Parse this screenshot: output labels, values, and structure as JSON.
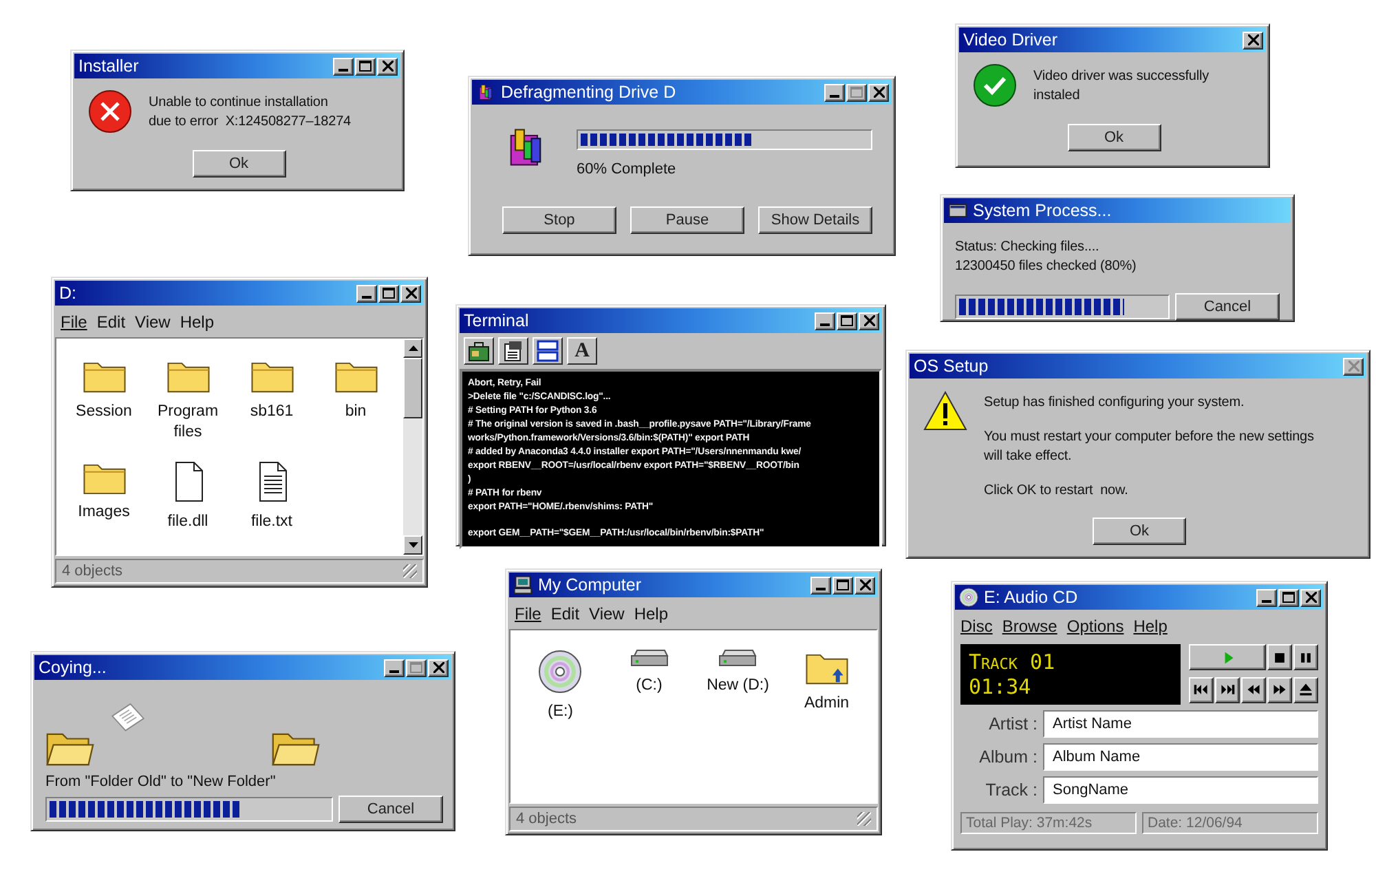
{
  "windows": [
    {
      "kind": "message",
      "title": "Installer",
      "title_buttons": [
        {
          "kind": "minimize",
          "disabled": false
        },
        {
          "kind": "maximize",
          "disabled": false
        },
        {
          "kind": "close",
          "disabled": false
        }
      ],
      "paragraphs": [
        "Unable to continue installation\ndue to error  X:124508277–18274"
      ],
      "buttons": [
        {
          "label": "Ok"
        }
      ]
    },
    {
      "kind": "progress",
      "title": "Defragmenting Drive D",
      "title_buttons": [
        {
          "kind": "minimize",
          "disabled": false
        },
        {
          "kind": "maximize",
          "disabled": true
        },
        {
          "kind": "close",
          "disabled": false
        }
      ],
      "level": 0.6,
      "caption": "60% Complete",
      "buttons": [
        {
          "label": "Stop"
        },
        {
          "label": "Pause"
        },
        {
          "label": "Show Details"
        }
      ]
    },
    {
      "kind": "message",
      "title": "Video Driver",
      "title_buttons": [
        {
          "kind": "close",
          "disabled": false
        }
      ],
      "paragraphs": [
        "Video driver was successfully\ninstaled"
      ],
      "buttons": [
        {
          "label": "Ok"
        }
      ]
    },
    {
      "kind": "status",
      "title": "System Process...",
      "paragraphs": [
        "Status: Checking files....\n12300450 files checked (80%)"
      ],
      "level": 0.8,
      "buttons": [
        {
          "label": "Cancel"
        }
      ]
    },
    {
      "kind": "message",
      "title": "OS Setup",
      "title_buttons": [
        {
          "kind": "close",
          "disabled": true
        }
      ],
      "paragraphs": [
        "Setup has finished configuring your system.",
        "You must restart your computer before the new settings\nwill take effect.",
        "Click OK to restart  now."
      ],
      "buttons": [
        {
          "label": "Ok"
        }
      ]
    },
    {
      "kind": "explorer",
      "title": "D:",
      "title_buttons": [
        {
          "kind": "minimize",
          "disabled": false
        },
        {
          "kind": "maximize",
          "disabled": false
        },
        {
          "kind": "close",
          "disabled": false
        }
      ],
      "menu": [
        {
          "label": "File",
          "underlined": true
        },
        {
          "label": "Edit",
          "underlined": false
        },
        {
          "label": "View",
          "underlined": false
        },
        {
          "label": "Help",
          "underlined": false
        }
      ],
      "items": [
        {
          "label": "Session",
          "kind": "folder"
        },
        {
          "label": "Program\nfiles",
          "kind": "folder"
        },
        {
          "label": "sb161",
          "kind": "folder"
        },
        {
          "label": "bin",
          "kind": "folder"
        },
        {
          "label": "Images",
          "kind": "folder"
        },
        {
          "label": "file.dll",
          "kind": "file"
        },
        {
          "label": "file.txt",
          "kind": "text-file"
        }
      ],
      "scrollbar": true,
      "status": "4 objects"
    },
    {
      "kind": "terminal",
      "title": "Terminal",
      "title_buttons": [
        {
          "kind": "minimize",
          "disabled": false
        },
        {
          "kind": "maximize",
          "disabled": false
        },
        {
          "kind": "close",
          "disabled": false
        }
      ],
      "toolbar": [
        {
          "kind": "briefcase"
        },
        {
          "kind": "properties"
        },
        {
          "kind": "windows"
        },
        {
          "kind": "font",
          "glyph": "A"
        }
      ],
      "blocks": [
        [
          "Abort, Retry, Fail",
          ">Delete file \"c:/SCANDISC.log\"...",
          "# Setting PATH for Python 3.6",
          "# The original version is saved in .bash__profile.pysave PATH=\"/Library/Frame",
          "works/Python.framework/Versions/3.6/bin:$(PATH)\" export PATH",
          "# added by Anaconda3 4.4.0 installer export PATH=\"/Users/nnenmandu kwe/",
          "export RBENV__ROOT=/usr/local/rbenv export PATH=\"$RBENV__ROOT/bin",
          ")",
          "# PATH for rbenv",
          "export PATH=\"HOME/.rbenv/shims: PATH\""
        ],
        [
          "export GEM__PATH=\"$GEM__PATH:/usr/local/bin/rbenv/bin:$PATH\""
        ]
      ]
    },
    {
      "kind": "copy",
      "title": "Coying...",
      "title_buttons": [
        {
          "kind": "minimize",
          "disabled": false
        },
        {
          "kind": "maximize",
          "disabled": true
        },
        {
          "kind": "close",
          "disabled": false
        }
      ],
      "caption": "From \"Folder Old\" to \"New Folder\"",
      "level": 0.68,
      "buttons": [
        {
          "label": "Cancel"
        }
      ]
    },
    {
      "kind": "explorer",
      "title": "My Computer",
      "title_buttons": [
        {
          "kind": "minimize",
          "disabled": false
        },
        {
          "kind": "maximize",
          "disabled": false
        },
        {
          "kind": "close",
          "disabled": false
        }
      ],
      "menu": [
        {
          "label": "File",
          "underlined": true
        },
        {
          "label": "Edit",
          "underlined": false
        },
        {
          "label": "View",
          "underlined": false
        },
        {
          "label": "Help",
          "underlined": false
        }
      ],
      "items": [
        {
          "label": "(E:)",
          "kind": "cd"
        },
        {
          "label": "(C:)",
          "kind": "drive"
        },
        {
          "label": "New (D:)",
          "kind": "drive"
        },
        {
          "label": "Admin",
          "kind": "user-folder"
        }
      ],
      "scrollbar": false,
      "status": "4 objects"
    },
    {
      "kind": "player",
      "title": "E: Audio CD",
      "title_buttons": [
        {
          "kind": "minimize",
          "disabled": false
        },
        {
          "kind": "maximize",
          "disabled": false
        },
        {
          "kind": "close",
          "disabled": false
        }
      ],
      "menu": [
        {
          "label": "Disc",
          "underlined": true
        },
        {
          "label": "Browse",
          "underlined": true
        },
        {
          "label": "Options",
          "underlined": true
        },
        {
          "label": "Help",
          "underlined": true
        }
      ],
      "display": [
        "Track 01",
        "01:34"
      ],
      "controls": [
        {
          "kind": "play"
        },
        {
          "kind": "stop"
        },
        {
          "kind": "pause"
        },
        {
          "kind": "previous-track"
        },
        {
          "kind": "next-track"
        },
        {
          "kind": "rewind"
        },
        {
          "kind": "fast-forward"
        },
        {
          "kind": "eject"
        }
      ],
      "fields": [
        {
          "label": "Artist :",
          "value": "Artist Name"
        },
        {
          "label": "Album :",
          "value": "Album Name"
        },
        {
          "label": "Track :",
          "value": "SongName"
        }
      ],
      "status": [
        "Total Play: 37m:42s",
        "Date: 12/06/94"
      ]
    }
  ]
}
